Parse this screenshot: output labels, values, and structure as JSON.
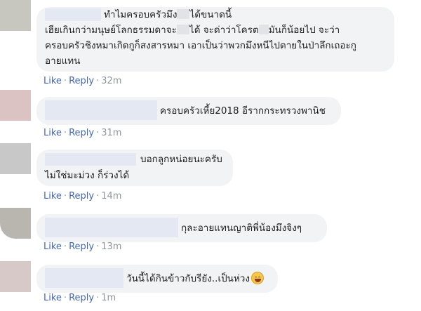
{
  "comments": [
    {
      "text_line1": "ทำไมครอบครัวมึง",
      "text_line1b": "ได้ขนาดนี้",
      "text_line2a": "เฮียเกินกว่ามนุษย์โลกธรรมดาจะ",
      "text_line2b": "ได้ จะด่าว่าโครต",
      "text_line2c": "มันก็น้อยไป จะว่า",
      "text_line3": "ครอบครัวชิงหมาเกิดกูก็สงสารหมา เอาเป็นว่าพวกมึงหนีไปตายในป่าลึกเถอะกู",
      "text_line4": "อายแทน",
      "like": "Like",
      "reply": "Reply",
      "time": "32m"
    },
    {
      "text": "ครอบครัวเหี้ย2018 อีรากกระทรวงพานิช",
      "like": "Like",
      "reply": "Reply",
      "time": "31m"
    },
    {
      "text_line1": "บอกลูกหน่อยนะครับ",
      "text_line2": "ไม่ใช่มะม่วง ก็ร่วงได้",
      "like": "Like",
      "reply": "Reply",
      "time": "14m"
    },
    {
      "text": "กุละอายแทนญาติพี่น้องมึงจิงๆ",
      "like": "Like",
      "reply": "Reply",
      "time": "13m"
    },
    {
      "text": "วันนี้ได้กินข้าวกับรียัง..เป็นห่วง",
      "emoji": "grinning-sweat-emoji",
      "like": "Like",
      "reply": "Reply",
      "time": "1m"
    }
  ],
  "dot": "·"
}
